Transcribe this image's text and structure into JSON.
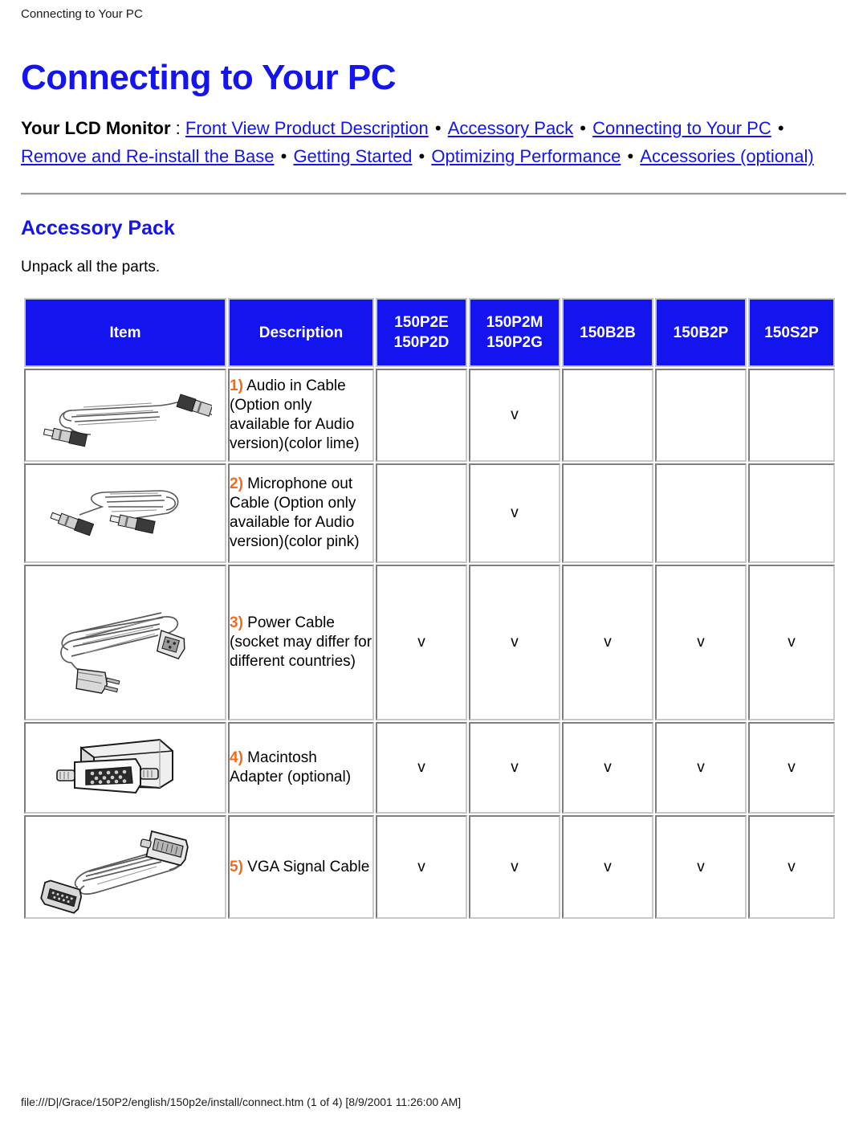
{
  "page": {
    "breadcrumb": "Connecting to Your PC",
    "title": "Connecting to Your PC",
    "footer": "file:///D|/Grace/150P2/english/150p2e/install/connect.htm (1 of 4) [8/9/2001 11:26:00 AM]"
  },
  "nav": {
    "lead": "Your LCD Monitor",
    "colon": " : ",
    "separator": " • ",
    "links": [
      "Front View Product Description",
      "Accessory Pack",
      "Connecting to Your PC",
      "Remove and Re-install the Base",
      "Getting Started",
      "Optimizing Performance",
      "Accessories (optional)"
    ]
  },
  "section": {
    "title": "Accessory Pack",
    "text": "Unpack all the parts."
  },
  "colors": {
    "heading_blue": "#1414ee",
    "link_blue": "#1414ee",
    "header_cell_blue": "#1414ee",
    "number_orange": "#f26a1b",
    "table_border": "#7d7d7d"
  },
  "table": {
    "headers": [
      {
        "label": "Item",
        "lines": [
          "Item"
        ]
      },
      {
        "label": "Description",
        "lines": [
          "Description"
        ]
      },
      {
        "label": "150P2E 150P2D",
        "lines": [
          "150P2E",
          "150P2D"
        ]
      },
      {
        "label": "150P2M 150P2G",
        "lines": [
          "150P2M",
          "150P2G"
        ]
      },
      {
        "label": "150B2B",
        "lines": [
          "150B2B"
        ]
      },
      {
        "label": "150B2P",
        "lines": [
          "150B2P"
        ]
      },
      {
        "label": "150S2P",
        "lines": [
          "150S2P"
        ]
      }
    ],
    "check_symbol": "v",
    "rows": [
      {
        "image": "audio-in-cable-image",
        "num": "1)",
        "description": " Audio in Cable (Option only available for Audio version)(color lime)",
        "marks": [
          "",
          "v",
          "",
          "",
          ""
        ]
      },
      {
        "image": "microphone-out-cable-image",
        "num": "2)",
        "description": " Microphone out Cable (Option only available for Audio version)(color pink)",
        "marks": [
          "",
          "v",
          "",
          "",
          ""
        ]
      },
      {
        "image": "power-cable-image",
        "num": "3)",
        "description": " Power Cable (socket may differ for different countries)",
        "marks": [
          "v",
          "v",
          "v",
          "v",
          "v"
        ]
      },
      {
        "image": "macintosh-adapter-image",
        "num": "4)",
        "description": " Macintosh Adapter (optional)",
        "marks": [
          "v",
          "v",
          "v",
          "v",
          "v"
        ]
      },
      {
        "image": "vga-signal-cable-image",
        "num": "5)",
        "description": " VGA Signal Cable",
        "marks": [
          "v",
          "v",
          "v",
          "v",
          "v"
        ]
      }
    ]
  }
}
